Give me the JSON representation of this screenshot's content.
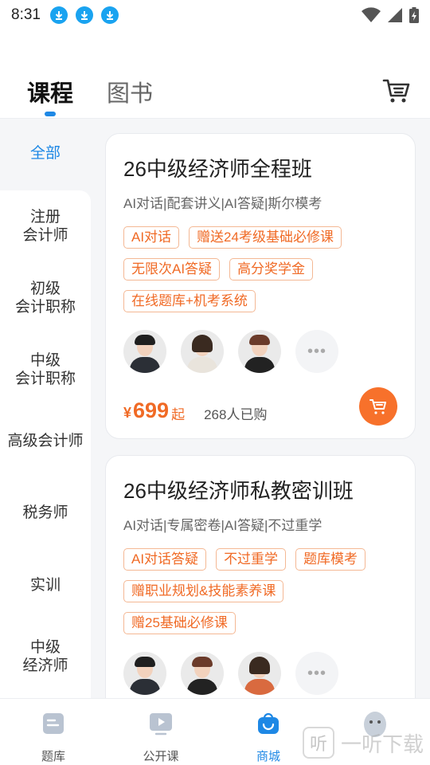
{
  "status_bar": {
    "time": "8:31",
    "notification_icons": [
      "download-icon",
      "download-icon",
      "download-icon"
    ],
    "right_icons": [
      "wifi-icon",
      "signal-icon",
      "battery-charging-icon"
    ]
  },
  "top_tabs": {
    "items": [
      {
        "label": "课程",
        "active": true
      },
      {
        "label": "图书",
        "active": false
      }
    ],
    "cart_icon": "cart-icon",
    "accent": "#1e88e5"
  },
  "categories": [
    {
      "label": "全部",
      "active": true
    },
    {
      "label": "注册\n会计师"
    },
    {
      "label": "初级\n会计职称"
    },
    {
      "label": "中级\n会计职称"
    },
    {
      "label": "高级会计师"
    },
    {
      "label": "税务师"
    },
    {
      "label": "实训"
    },
    {
      "label": "中级\n经济师"
    }
  ],
  "courses": [
    {
      "title": "26中级经济师全程班",
      "subtitle": "AI对话|配套讲义|AI答疑|斯尔模考",
      "tags": [
        "AI对话",
        "赠送24考级基础必修课",
        "无限次AI答疑",
        "高分奖学金",
        "在线题库+机考系统"
      ],
      "price_symbol": "¥",
      "price": "699",
      "price_suffix": "起",
      "buyers": "268人已购"
    },
    {
      "title": "26中级经济师私教密训班",
      "subtitle": "AI对话|专属密卷|AI答疑|不过重学",
      "tags": [
        "AI对话答疑",
        "不过重学",
        "题库模考",
        "赠职业规划&技能素养课",
        "赠25基础必修课"
      ]
    }
  ],
  "price_color": "#f06a25",
  "bottom_nav": [
    {
      "label": "题库",
      "icon": "question-bank-icon"
    },
    {
      "label": "公开课",
      "icon": "play-screen-icon"
    },
    {
      "label": "商城",
      "icon": "shopping-bag-icon",
      "active": true
    },
    {
      "label": "",
      "icon": "mascot-avatar-icon"
    }
  ],
  "watermark": {
    "glyph": "听",
    "text": "一听下载"
  }
}
